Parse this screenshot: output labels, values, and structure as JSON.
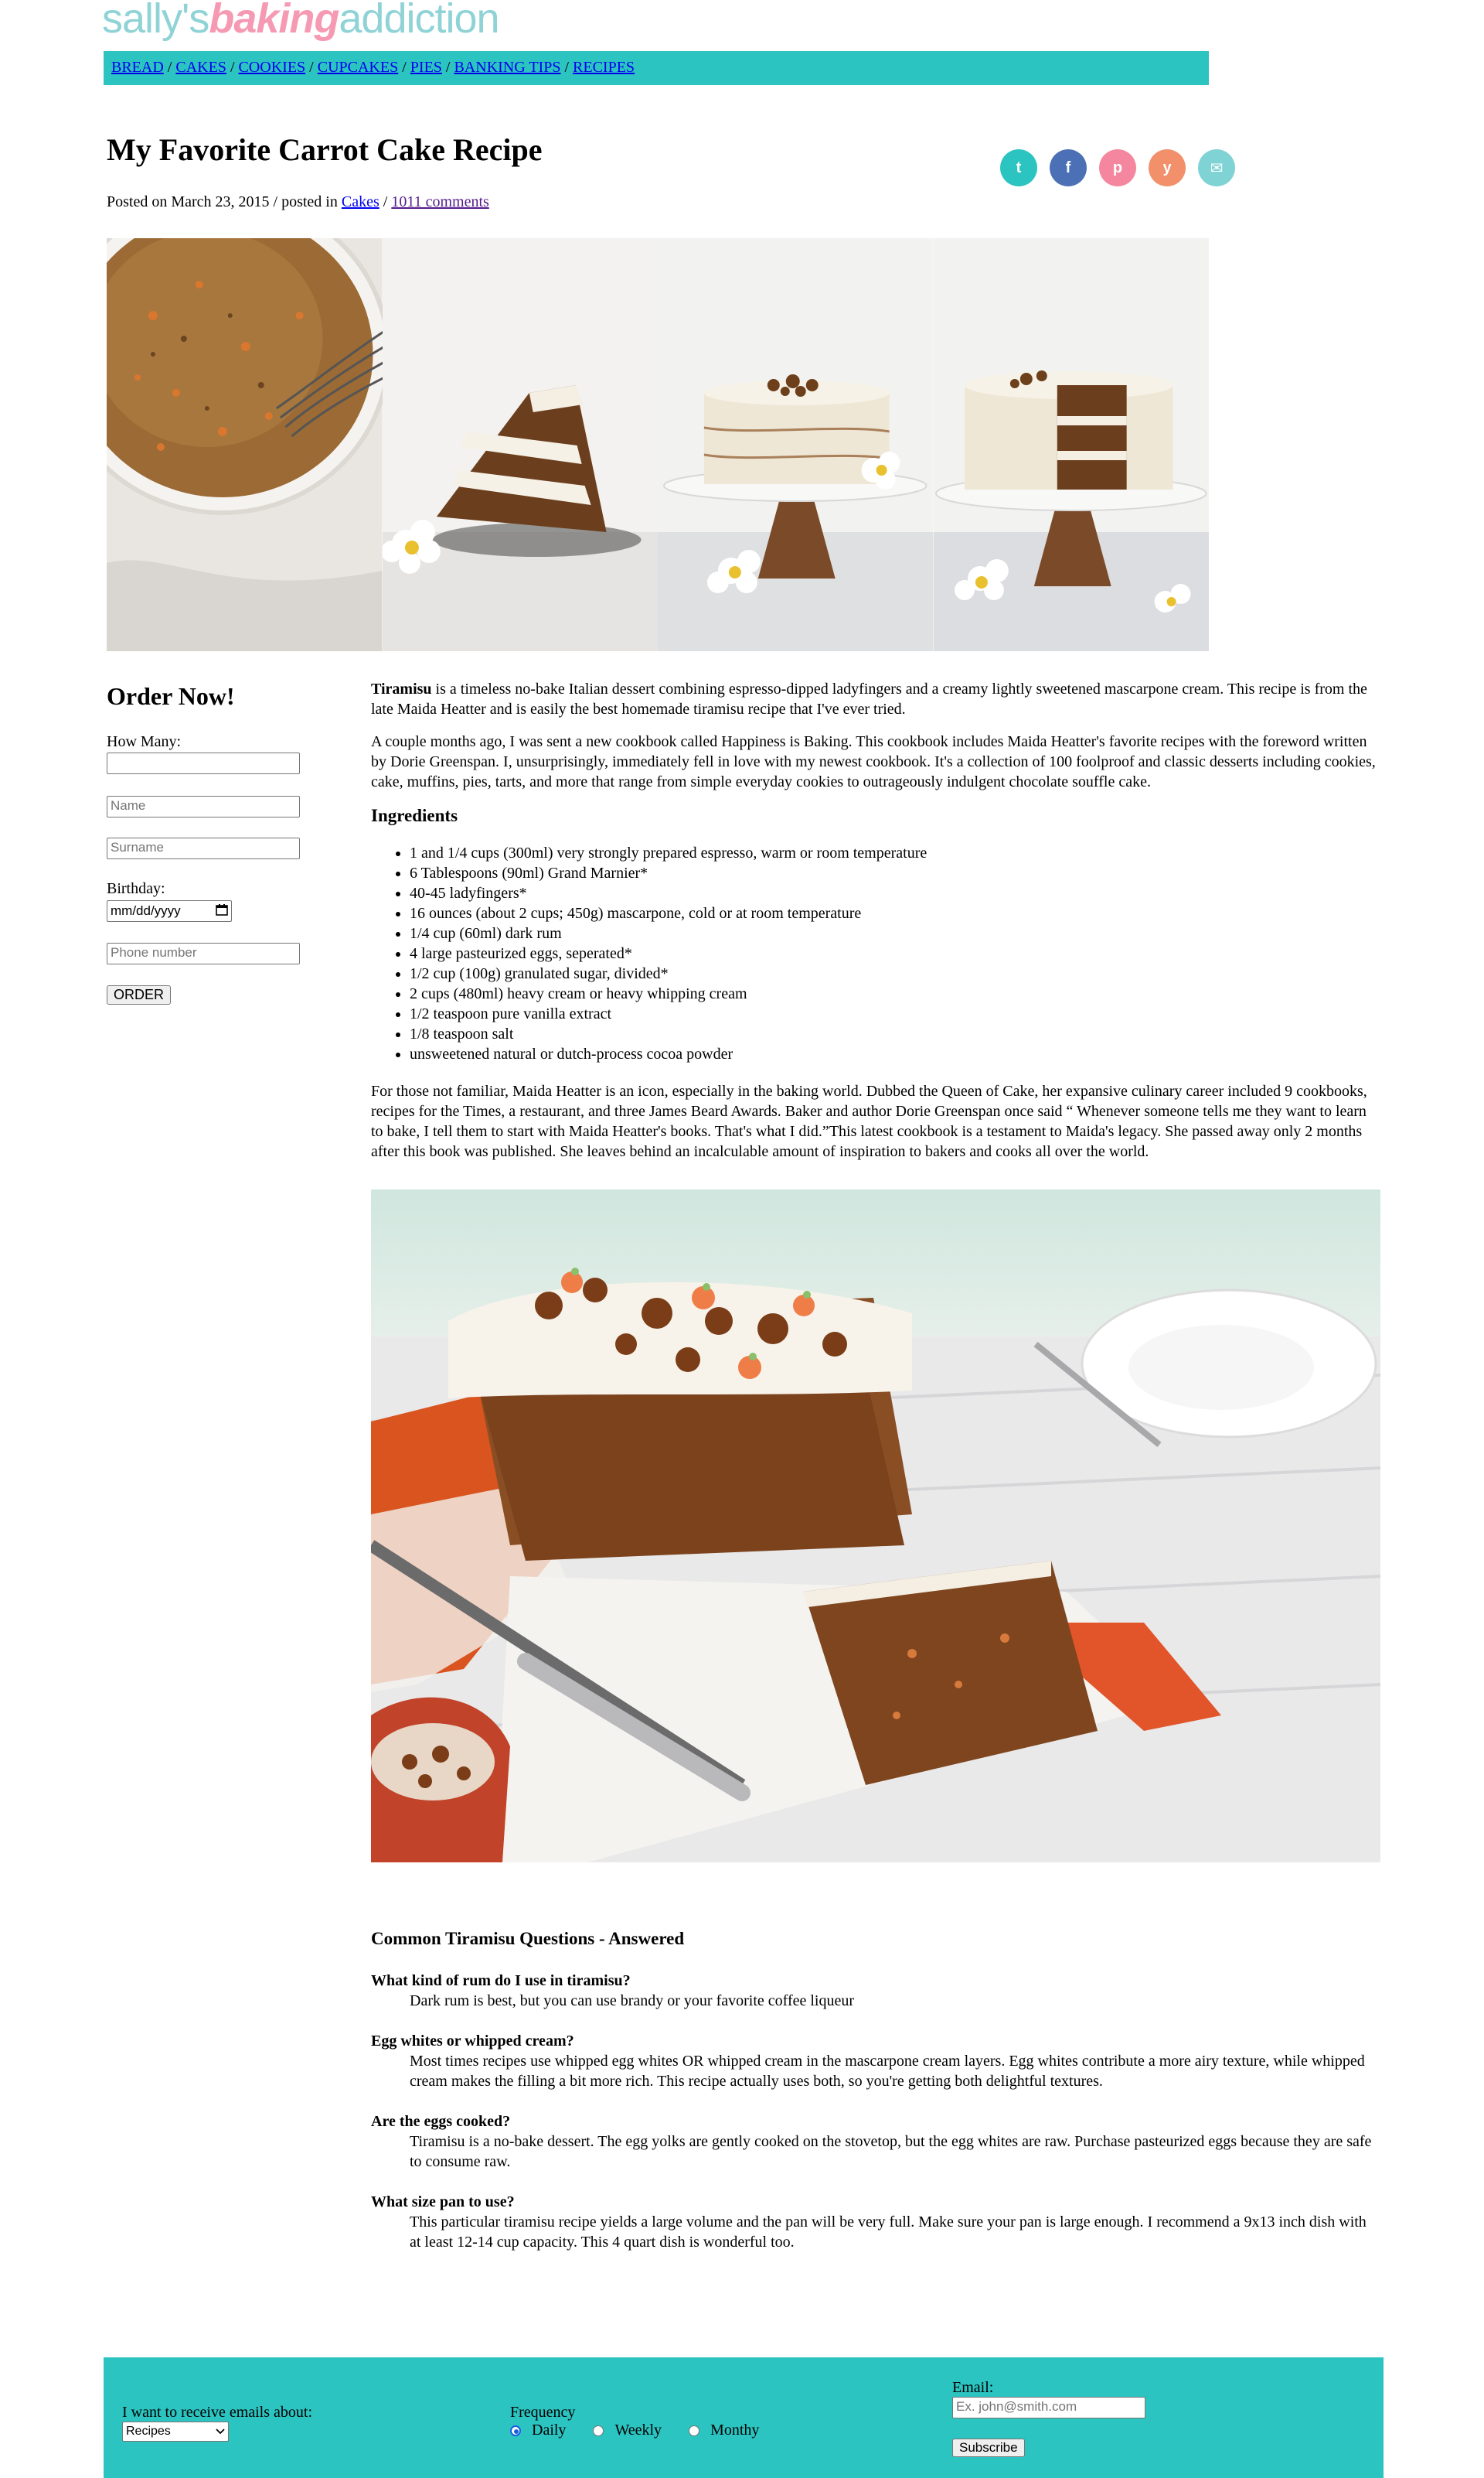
{
  "logo": {
    "part1": "sally's",
    "part2": "baking",
    "part3": "addiction"
  },
  "nav": [
    {
      "label": "BREAD"
    },
    {
      "label": "CAKES"
    },
    {
      "label": "COOKIES"
    },
    {
      "label": "CUPCAKES"
    },
    {
      "label": "PIES"
    },
    {
      "label": "BANKING TIPS"
    },
    {
      "label": "RECIPES"
    }
  ],
  "nav_separator": " / ",
  "post": {
    "title": "My Favorite Carrot Cake Recipe",
    "posted_prefix": "Posted on March 23, 2015 / posted in ",
    "category": "Cakes",
    "meta_sep": " / ",
    "comments": "1011 comments"
  },
  "share": {
    "twitter_glyph": "t",
    "facebook_glyph": "f",
    "pinterest_glyph": "p",
    "yummly_glyph": "y",
    "email_glyph": "✉",
    "colors": {
      "twitter": "#2bc4c1",
      "facebook": "#4b70b5",
      "pinterest": "#f4879f",
      "yummly": "#f1906a",
      "email": "#7fd3d4"
    }
  },
  "order_form": {
    "title": "Order Now!",
    "how_many_label": "How Many:",
    "name_placeholder": "Name",
    "surname_placeholder": "Surname",
    "birthday_label": "Birthday:",
    "birthday_value": "mm/dd/yyyy",
    "phone_placeholder": "Phone number",
    "order_button": "ORDER"
  },
  "intro": {
    "bold": "Tiramisu",
    "text": " is a timeless no-bake Italian dessert combining espresso-dipped ladyfingers and a creamy lightly sweetened mascarpone cream. This recipe is from the late Maida Heatter and is easily the best homemade tiramisu recipe that I've ever tried."
  },
  "paragraph2": "A couple months ago, I was sent a new cookbook called Happiness is Baking. This cookbook includes Maida Heatter's favorite recipes with the foreword written by Dorie Greenspan. I, unsurprisingly, immediately fell in love with my newest cookbook. It's a collection of 100 foolproof and classic desserts including cookies, cake, muffins, pies, tarts, and more that range from simple everyday cookies to outrageously indulgent chocolate souffle cake.",
  "ingredients_title": "Ingredients",
  "ingredients": [
    "1 and 1/4 cups (300ml) very strongly prepared espresso, warm or room temperature",
    "6 Tablespoons (90ml) Grand Marnier*",
    "40-45 ladyfingers*",
    "16 ounces (about 2 cups; 450g) mascarpone, cold or at room temperature",
    "1/4 cup (60ml) dark rum",
    "4 large pasteurized eggs, seperated*",
    "1/2 cup (100g) granulated sugar, divided*",
    "2 cups (480ml) heavy cream or heavy whipping cream",
    "1/2 teaspoon pure vanilla extract",
    "1/8 teaspoon salt",
    "unsweetened natural or dutch-process cocoa powder"
  ],
  "paragraph3": "For those not familiar, Maida Heatter is an icon, especially in the baking world. Dubbed the Queen of Cake, her expansive culinary career included 9 cookbooks, recipes for the Times, a restaurant, and three James Beard Awards. Baker and author Dorie Greenspan once said “ Whenever someone tells me they want to learn to bake, I tell them to start with Maida Heatter's books. That's what I did.”This latest cookbook is a testament to Maida's legacy. She passed away only 2 months after this book was published. She leaves behind an incalculable amount of inspiration to bakers and cooks all over the world.",
  "faq": {
    "title": "Common Tiramisu Questions - Answered",
    "items": [
      {
        "q": "What kind of rum do I use in tiramisu?",
        "a": "Dark rum is best, but you can use brandy or your favorite coffee liqueur"
      },
      {
        "q": "Egg whites or whipped cream?",
        "a": "Most times recipes use whipped egg whites OR whipped cream in the mascarpone cream layers. Egg whites contribute a more airy texture, while whipped cream makes the filling a bit more rich. This recipe actually uses both, so you're getting both delightful textures."
      },
      {
        "q": "Are the eggs cooked?",
        "a": "Tiramisu is a no-bake dessert. The egg yolks are gently cooked on the stovetop, but the egg whites are raw. Purchase pasteurized eggs because they are safe to consume raw."
      },
      {
        "q": "What size pan to use?",
        "a": "This particular tiramisu recipe yields a large volume and the pan will be very full. Make sure your pan is large enough. I recommend a 9x13 inch dish with at least 12-14 cup capacity. This 4 quart dish is wonderful too."
      }
    ]
  },
  "footer": {
    "emails_label": "I want to receive emails about:",
    "emails_selected": "Recipes",
    "frequency_label": "Frequency",
    "freq_options": [
      "Daily",
      "Weekly",
      "Monthy"
    ],
    "freq_selected": "Daily",
    "email_label": "Email:",
    "email_placeholder": "Ex. john@smith.com",
    "subscribe_button": "Subscribe"
  }
}
